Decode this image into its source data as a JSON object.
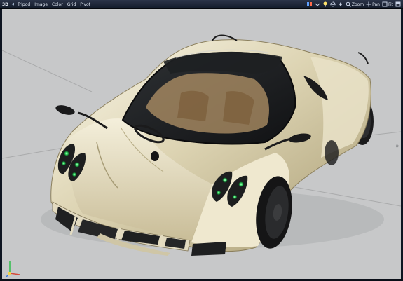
{
  "menubar": {
    "badge": "3D",
    "items": [
      "Tripod",
      "Image",
      "Color",
      "Grid",
      "Pivot"
    ]
  },
  "view_controls": {
    "zoom": "Zoom",
    "pan": "Pan",
    "fit": "Fit"
  },
  "icons": [
    "dropdown-arrow-icon",
    "lightbulb-icon",
    "gear-icon",
    "pin-icon",
    "maximize-icon",
    "sidebar-expand-icon",
    "axis-gizmo-icon"
  ],
  "colors": {
    "menubar_bg": "#1c2536",
    "viewport_bg": "#c7c8c9",
    "car_body": "#ddd5b7",
    "headlight_green": "#2fd45c"
  }
}
